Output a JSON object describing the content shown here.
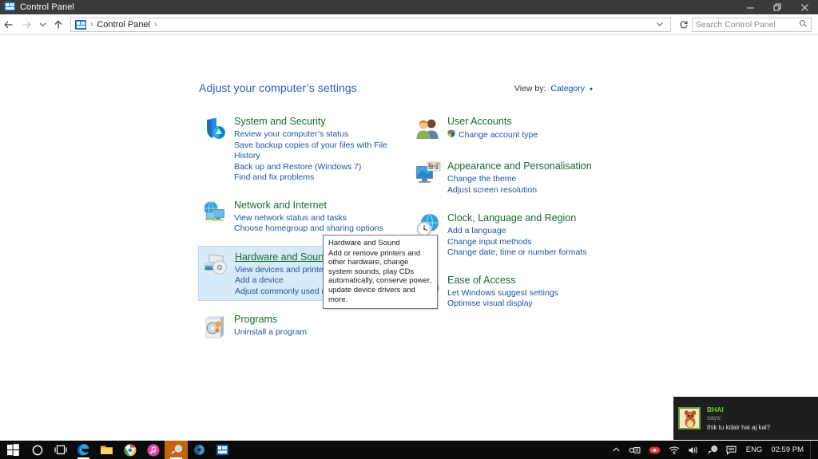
{
  "window": {
    "title": "Control Panel",
    "icon": "control-panel-icon",
    "buttons": {
      "minimize": "minimize-icon",
      "restore": "restore-icon",
      "close": "close-icon"
    }
  },
  "navbar": {
    "back": "back-arrow-icon",
    "forward": "forward-arrow-icon",
    "recent": "chevron-down-icon",
    "up": "up-arrow-icon",
    "breadcrumb": {
      "icon": "control-panel-icon",
      "items": [
        "Control Panel"
      ],
      "separator": "›",
      "trailing_separator": "›"
    },
    "address_dropdown": "chevron-down-icon",
    "refresh": "refresh-icon",
    "search": {
      "placeholder": "Search Control Panel",
      "value": "",
      "icon": "search-icon"
    }
  },
  "main": {
    "heading": "Adjust your computer’s settings",
    "view_by": {
      "label": "View by:",
      "value": "Category",
      "caret": "▾"
    },
    "categories_left": [
      {
        "icon": "shield-security-icon",
        "title": "System and Security",
        "links": [
          "Review your computer’s status",
          "Save backup copies of your files with File History",
          "Back up and Restore (Windows 7)",
          "Find and fix problems"
        ],
        "highlighted": false
      },
      {
        "icon": "network-globe-monitor-icon",
        "title": "Network and Internet",
        "links": [
          "View network status and tasks",
          "Choose homegroup and sharing options"
        ],
        "highlighted": false
      },
      {
        "icon": "printer-speaker-icon",
        "title": "Hardware and Sound",
        "links": [
          "View devices and printers",
          "Add a device",
          "Adjust commonly used mobility settings"
        ],
        "highlighted": true
      },
      {
        "icon": "programs-cd-box-icon",
        "title": "Programs",
        "links": [
          "Uninstall a program"
        ],
        "highlighted": false
      }
    ],
    "categories_right": [
      {
        "icon": "user-accounts-people-icon",
        "title": "User Accounts",
        "links": [
          "Change account type"
        ],
        "link_icons": [
          "uac-shield-icon"
        ],
        "highlighted": false
      },
      {
        "icon": "appearance-monitor-palette-icon",
        "title": "Appearance and Personalisation",
        "links": [
          "Change the theme",
          "Adjust screen resolution"
        ],
        "highlighted": false
      },
      {
        "icon": "clock-globe-icon",
        "title": "Clock, Language and Region",
        "links": [
          "Add a language",
          "Change input methods",
          "Change date, time or number formats"
        ],
        "highlighted": false
      },
      {
        "icon": "ease-of-access-icon",
        "title": "Ease of Access",
        "links": [
          "Let Windows suggest settings",
          "Optimise visual display"
        ],
        "highlighted": false
      }
    ]
  },
  "tooltip": {
    "title": "Hardware and Sound",
    "body": "Add or remove printers and other hardware, change system sounds, play CDs automatically, conserve power, update device drivers and more."
  },
  "notification": {
    "avatar": "cartoon-mouse-avatar",
    "sender": "BHAI",
    "says_label": "says:",
    "message": "thik tu kdair hai aj kal?"
  },
  "taskbar": {
    "items": [
      {
        "name": "start-button",
        "icon": "windows-logo-icon"
      },
      {
        "name": "cortana-search",
        "icon": "circle-icon"
      },
      {
        "name": "task-view",
        "icon": "task-view-icon"
      },
      {
        "name": "edge-browser",
        "icon": "edge-icon"
      },
      {
        "name": "file-explorer",
        "icon": "folder-icon"
      },
      {
        "name": "chrome-browser",
        "icon": "chrome-icon"
      },
      {
        "name": "itunes",
        "icon": "itunes-icon"
      },
      {
        "name": "messenger-app",
        "icon": "comet-icon"
      },
      {
        "name": "media-app",
        "icon": "moon-icon"
      },
      {
        "name": "control-panel-window",
        "icon": "control-panel-icon"
      }
    ],
    "tray": {
      "overflow": "chevron-up-icon",
      "items": [
        {
          "name": "tray-device",
          "icon": "device-icon"
        },
        {
          "name": "tray-antivirus",
          "icon": "red-shield-icon"
        },
        {
          "name": "tray-network",
          "icon": "wifi-icon"
        },
        {
          "name": "tray-volume",
          "icon": "speaker-icon"
        },
        {
          "name": "tray-messenger",
          "icon": "comet-icon"
        },
        {
          "name": "tray-action-center",
          "icon": "action-center-icon"
        }
      ],
      "language": "ENG",
      "clock": "02:59 PM"
    }
  }
}
